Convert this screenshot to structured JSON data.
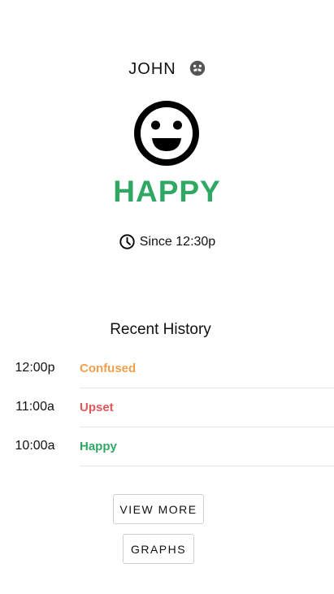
{
  "user": {
    "name": "JOHN",
    "switch_icon": "mood-face-icon"
  },
  "current": {
    "face_icon": "smiley-face-icon",
    "mood": "HAPPY",
    "mood_color": "#2fa863",
    "clock_icon": "clock-icon",
    "since_text": "Since 12:30p"
  },
  "history": {
    "title": "Recent History",
    "items": [
      {
        "time": "12:00p",
        "mood": "Confused",
        "color": "#f0a04b"
      },
      {
        "time": "11:00a",
        "mood": "Upset",
        "color": "#e0585b"
      },
      {
        "time": "10:00a",
        "mood": "Happy",
        "color": "#2fa863"
      }
    ]
  },
  "buttons": {
    "view_more": "VIEW MORE",
    "graphs": "GRAPHS"
  }
}
